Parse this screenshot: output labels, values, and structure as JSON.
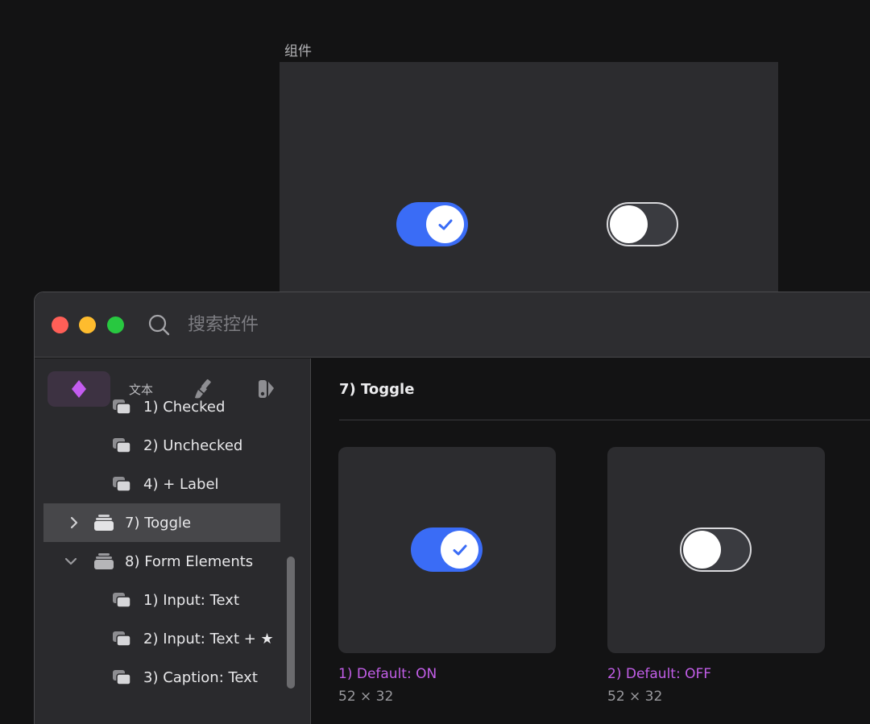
{
  "canvas": {
    "artboard_label": "组件"
  },
  "window": {
    "search": {
      "placeholder": "搜索控件",
      "value": ""
    }
  },
  "sidebar": {
    "tabs": [
      {
        "name": "components",
        "label": "",
        "icon": "diamond-icon",
        "active": true
      },
      {
        "name": "text",
        "label": "文本",
        "active": false
      },
      {
        "name": "styles",
        "label": "",
        "icon": "brush-icon",
        "active": false
      },
      {
        "name": "colors",
        "label": "",
        "icon": "color-swatch-icon",
        "active": false
      }
    ],
    "items": [
      {
        "label": "1) Checked"
      },
      {
        "label": "2) Unchecked"
      },
      {
        "label": "4) + Label"
      },
      {
        "label": "7) Toggle",
        "expanded": false,
        "selected": true
      },
      {
        "label": "8) Form Elements",
        "expanded": true
      },
      {
        "label": "1) Input: Text"
      },
      {
        "label": "2) Input: Text + ★"
      },
      {
        "label": "3) Caption: Text"
      }
    ]
  },
  "main": {
    "section_title": "7) Toggle",
    "cards": [
      {
        "name": "1) Default: ON",
        "size": "52 × 32",
        "state": "on"
      },
      {
        "name": "2) Default: OFF",
        "size": "52 × 32",
        "state": "off"
      }
    ]
  },
  "colors": {
    "accent_blue": "#3a6cf6",
    "component_name": "#c25ee8",
    "active_tab": "#3d3242",
    "diamond": "#c45cf0"
  }
}
